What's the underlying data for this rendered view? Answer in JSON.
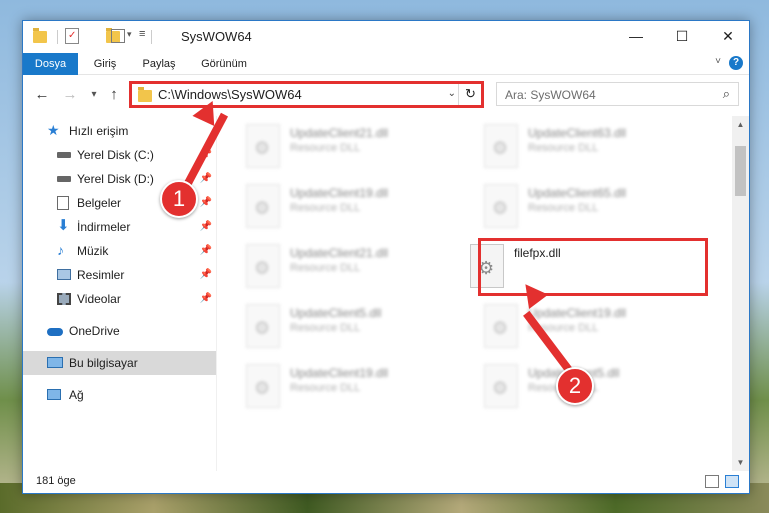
{
  "window": {
    "title": "SysWOW64",
    "controls": {
      "minimize": "—",
      "maximize": "☐",
      "close": "✕"
    }
  },
  "ribbon": {
    "tabs": [
      "Dosya",
      "Giriş",
      "Paylaş",
      "Görünüm"
    ],
    "help": "?"
  },
  "nav": {
    "back": "←",
    "forward": "→",
    "recent": "▾",
    "up": "↑",
    "address": "C:\\Windows\\SysWOW64",
    "refresh": "↻",
    "search_placeholder": "Ara: SysWOW64"
  },
  "sidebar": {
    "items": [
      {
        "label": "Hızlı erişim",
        "icon": "star-icon"
      },
      {
        "label": "Yerel Disk (C:)",
        "icon": "drive-icon",
        "pinned": true
      },
      {
        "label": "Yerel Disk (D:)",
        "icon": "drive-icon",
        "pinned": true
      },
      {
        "label": "Belgeler",
        "icon": "documents-icon",
        "pinned": true
      },
      {
        "label": "İndirmeler",
        "icon": "download-icon",
        "pinned": true
      },
      {
        "label": "Müzik",
        "icon": "music-icon",
        "pinned": true
      },
      {
        "label": "Resimler",
        "icon": "pictures-icon",
        "pinned": true
      },
      {
        "label": "Videolar",
        "icon": "videos-icon",
        "pinned": true
      },
      {
        "label": "OneDrive",
        "icon": "cloud-icon"
      },
      {
        "label": "Bu bilgisayar",
        "icon": "computer-icon",
        "selected": true
      },
      {
        "label": "Ağ",
        "icon": "network-icon"
      }
    ]
  },
  "files": [
    {
      "name": "UpdateClient21.dll",
      "type": "Resource DLL",
      "blurred": true
    },
    {
      "name": "UpdateClient63.dll",
      "type": "Resource DLL",
      "blurred": true
    },
    {
      "name": "UpdateClient19.dll",
      "type": "Resource DLL",
      "blurred": true
    },
    {
      "name": "UpdateClient65.dll",
      "type": "Resource DLL",
      "blurred": true
    },
    {
      "name": "UpdateClient21.dll",
      "type": "Resource DLL",
      "blurred": true
    },
    {
      "name": "filefpx.dll",
      "type": "",
      "blurred": false
    },
    {
      "name": "UpdateClient5.dll",
      "type": "Resource DLL",
      "blurred": true
    },
    {
      "name": "UpdateClient19.dll",
      "type": "Resource DLL",
      "blurred": true
    },
    {
      "name": "UpdateClient19.dll",
      "type": "Resource DLL",
      "blurred": true
    },
    {
      "name": "UpdateClient5.dll",
      "type": "Resource DLL",
      "blurred": true
    }
  ],
  "status": {
    "count": "181 öge"
  },
  "annotations": {
    "step1": "1",
    "step2": "2"
  },
  "colors": {
    "accent": "#1979ca",
    "highlight": "#e3302f",
    "selected": "#d9d9d9"
  }
}
